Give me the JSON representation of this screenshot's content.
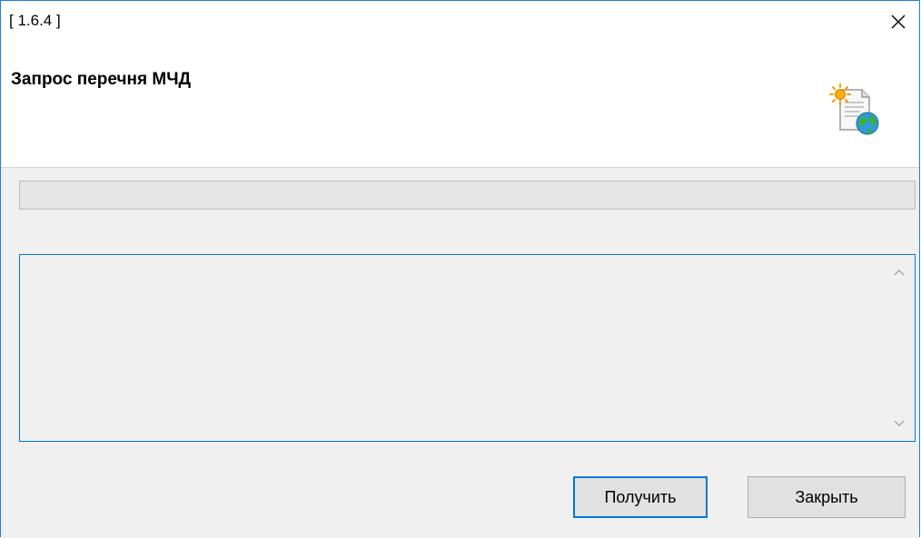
{
  "window": {
    "title": "[ 1.6.4 ]",
    "close_icon": "close-icon"
  },
  "header": {
    "title": "Запрос перечня МЧД",
    "icon": "document-globe-icon"
  },
  "progress": {
    "value": 0
  },
  "log": {
    "text": ""
  },
  "buttons": {
    "get_label": "Получить",
    "close_label": "Закрыть"
  },
  "colors": {
    "accent": "#0078d7",
    "window_border": "#1883d7",
    "background": "#f0f0f0"
  }
}
